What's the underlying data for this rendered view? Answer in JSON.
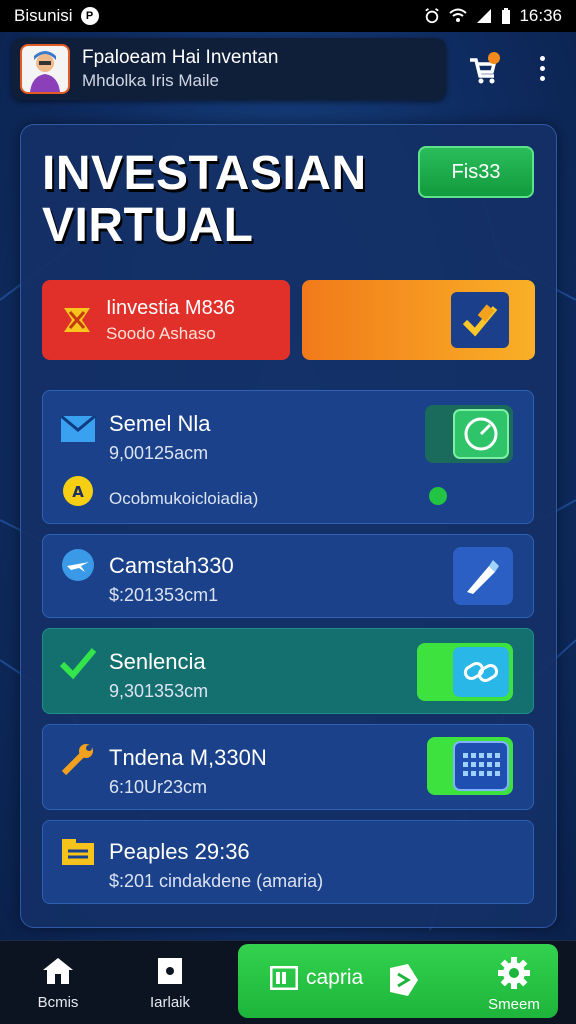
{
  "status_bar": {
    "carrier": "Bisunisi",
    "notification_icon": "p-badge-icon",
    "time": "16:36"
  },
  "header": {
    "title": "Fpaloeam Hai Inventan",
    "subtitle": "Mhdolka Iris Maile"
  },
  "main": {
    "title": "INVESTASIAN VIRTUAL",
    "top_button": "Fis33",
    "red_card": {
      "title": "Iinvestia M836",
      "subtitle": "Soodo Ashaso"
    },
    "cards": [
      {
        "title": "Semel Nla",
        "value": "9,00125acm",
        "extra": "Ocobmukoicloiadia)",
        "icon": "mail-icon",
        "right_icon": "gauge-icon",
        "style": "blue"
      },
      {
        "title": "Camstah330",
        "value": "$:201353cm1",
        "icon": "plane-icon",
        "right_icon": "pen-icon",
        "style": "blue"
      },
      {
        "title": "Senlencia",
        "value": "9,301353cm",
        "icon": "check-icon",
        "right_icon": "link-icon",
        "style": "green"
      },
      {
        "title": "Tndena M,330N",
        "value": "6:10Ur23cm",
        "icon": "wrench-icon",
        "right_icon": "calendar-icon",
        "style": "blue"
      },
      {
        "title": "Peaples 29:36",
        "value": "$:201 cindakdene (amaria)",
        "icon": "folder-icon",
        "style": "blue"
      }
    ]
  },
  "bottom_nav": {
    "home_label": "Bcmis",
    "second_label": "Iarlaik",
    "green_label": "capria",
    "settings_label": "Smeem"
  },
  "colors": {
    "accent_green": "#22c444",
    "red": "#e12f2a",
    "orange": "#f39a22",
    "panel_blue": "#133066"
  }
}
